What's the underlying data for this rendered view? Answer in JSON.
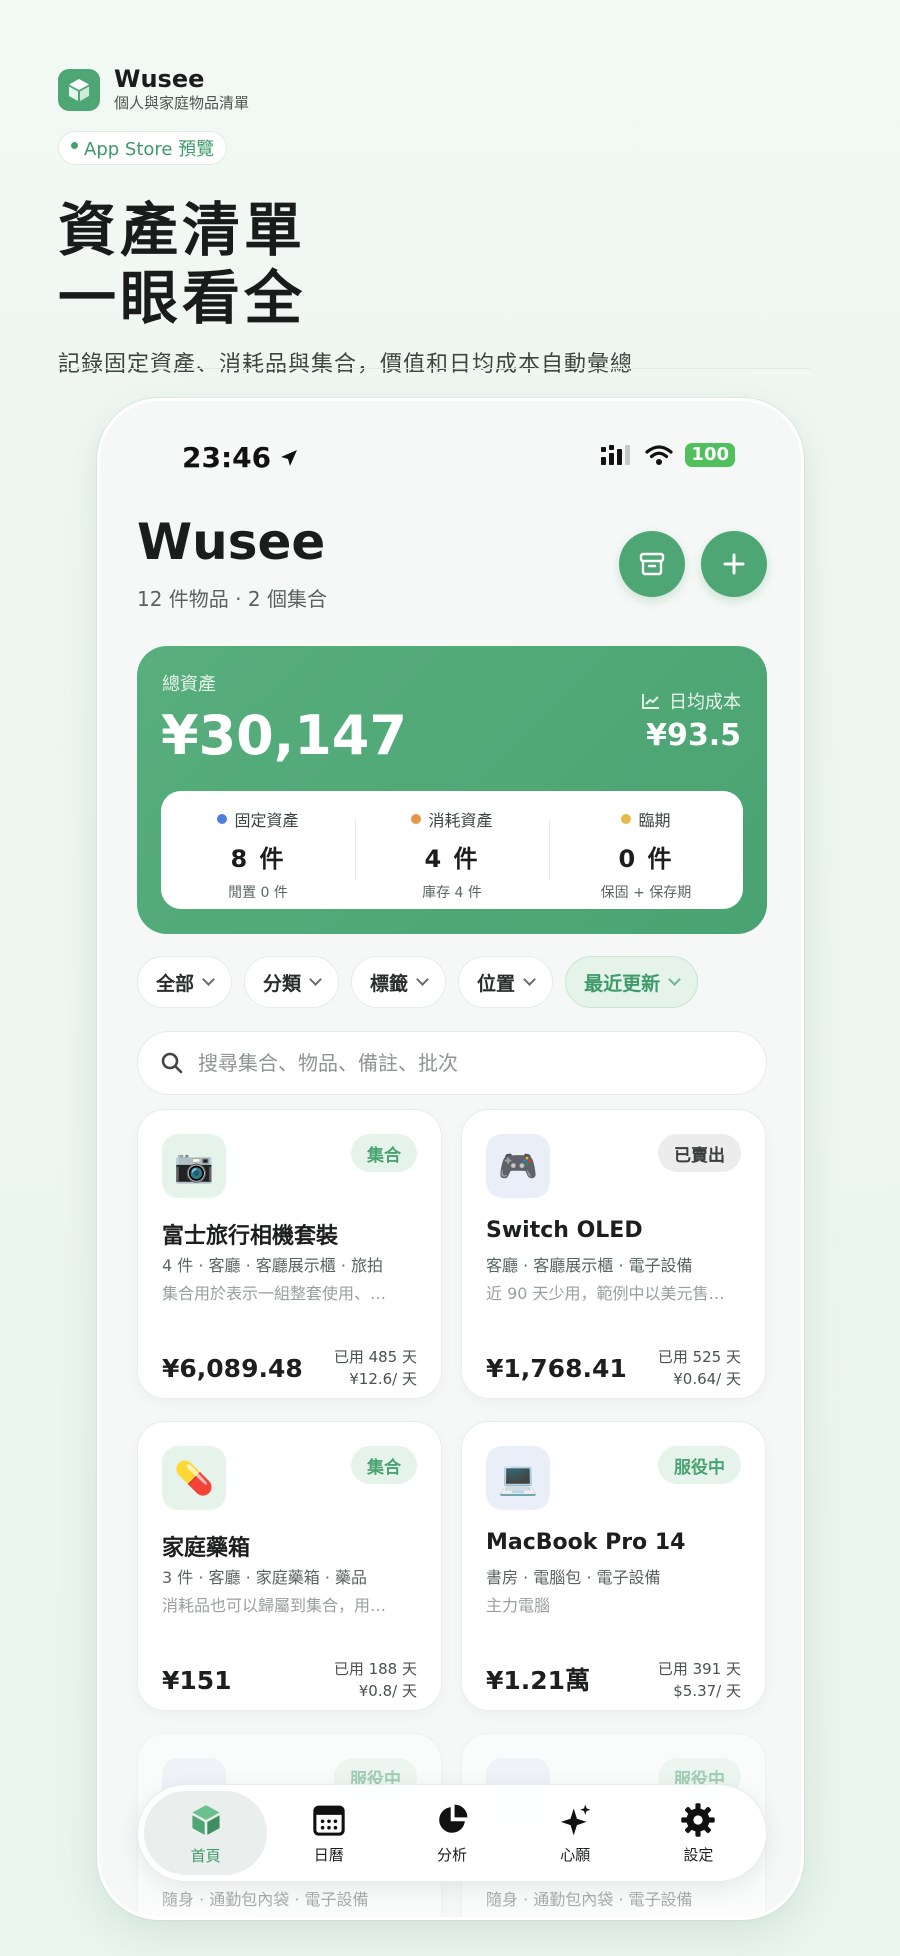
{
  "brand": {
    "name": "Wusee",
    "subtitle": "個人與家庭物品清單",
    "store_badge": "App Store 預覽"
  },
  "hero": {
    "title_line1": "資產清單",
    "title_line2": "一眼看全",
    "subtitle": "記錄固定資產、消耗品與集合，價值和日均成本自動彙總"
  },
  "status_bar": {
    "time": "23:46",
    "battery": "100"
  },
  "header": {
    "title": "Wusee",
    "subtitle": "12 件物品 · 2 個集合"
  },
  "summary": {
    "total_label": "總資產",
    "total_value": "¥30,147",
    "daily_label": "日均成本",
    "daily_value": "¥93.5",
    "stats": [
      {
        "label": "固定資產",
        "value": "8 件",
        "foot": "閒置 0 件",
        "color": "#4a7fe0"
      },
      {
        "label": "消耗資產",
        "value": "4 件",
        "foot": "庫存 4 件",
        "color": "#e8944a"
      },
      {
        "label": "臨期",
        "value": "0 件",
        "foot": "保固 + 保存期",
        "color": "#e7b84a"
      }
    ]
  },
  "filters": [
    {
      "label": "全部"
    },
    {
      "label": "分類"
    },
    {
      "label": "標籤"
    },
    {
      "label": "位置"
    },
    {
      "label": "最近更新"
    }
  ],
  "search": {
    "placeholder": "搜尋集合、物品、備註、批次"
  },
  "items": [
    {
      "icon": "camera-icon",
      "emoji": "📷",
      "badge": "集合",
      "title": "富士旅行相機套裝",
      "meta": "4 件 · 客廳 · 客廳展示櫃 · 旅拍",
      "note": "集合用於表示一組整套使用、…",
      "price": "¥6,089.48",
      "used": "已用 485 天",
      "per_day": "¥12.6/ 天"
    },
    {
      "icon": "gamepad-icon",
      "emoji": "🎮",
      "badge": "已賣出",
      "title": "Switch OLED",
      "meta": "客廳 · 客廳展示櫃 · 電子設備",
      "note": "近 90 天少用，範例中以美元售…",
      "price": "¥1,768.41",
      "used": "已用 525 天",
      "per_day": "¥0.64/ 天"
    },
    {
      "icon": "pill-icon",
      "emoji": "💊",
      "badge": "集合",
      "title": "家庭藥箱",
      "meta": "3 件 · 客廳 · 家庭藥箱 · 藥品",
      "note": "消耗品也可以歸屬到集合，用…",
      "price": "¥151",
      "used": "已用 188 天",
      "per_day": "¥0.8/ 天"
    },
    {
      "icon": "laptop-icon",
      "emoji": "💻",
      "badge": "服役中",
      "title": "MacBook Pro 14",
      "meta": "書房 · 電腦包 · 電子設備",
      "note": "主力電腦",
      "price": "¥1.21萬",
      "used": "已用 391 天",
      "per_day": "$5.37/ 天"
    },
    {
      "badge": "服役中",
      "meta": "隨身 · 通勤包內袋 · 電子設備"
    },
    {
      "badge": "服役中",
      "meta": "隨身 · 通勤包內袋 · 電子設備"
    }
  ],
  "tabbar": [
    {
      "label": "首頁",
      "icon": "box-icon"
    },
    {
      "label": "日曆",
      "icon": "calendar-icon"
    },
    {
      "label": "分析",
      "icon": "pie-chart-icon"
    },
    {
      "label": "心願",
      "icon": "sparkle-icon"
    },
    {
      "label": "設定",
      "icon": "gear-icon"
    }
  ],
  "colors": {
    "accent": "#4fa675",
    "accent_light": "#e5f3ea",
    "background": "#f2f8f4"
  }
}
